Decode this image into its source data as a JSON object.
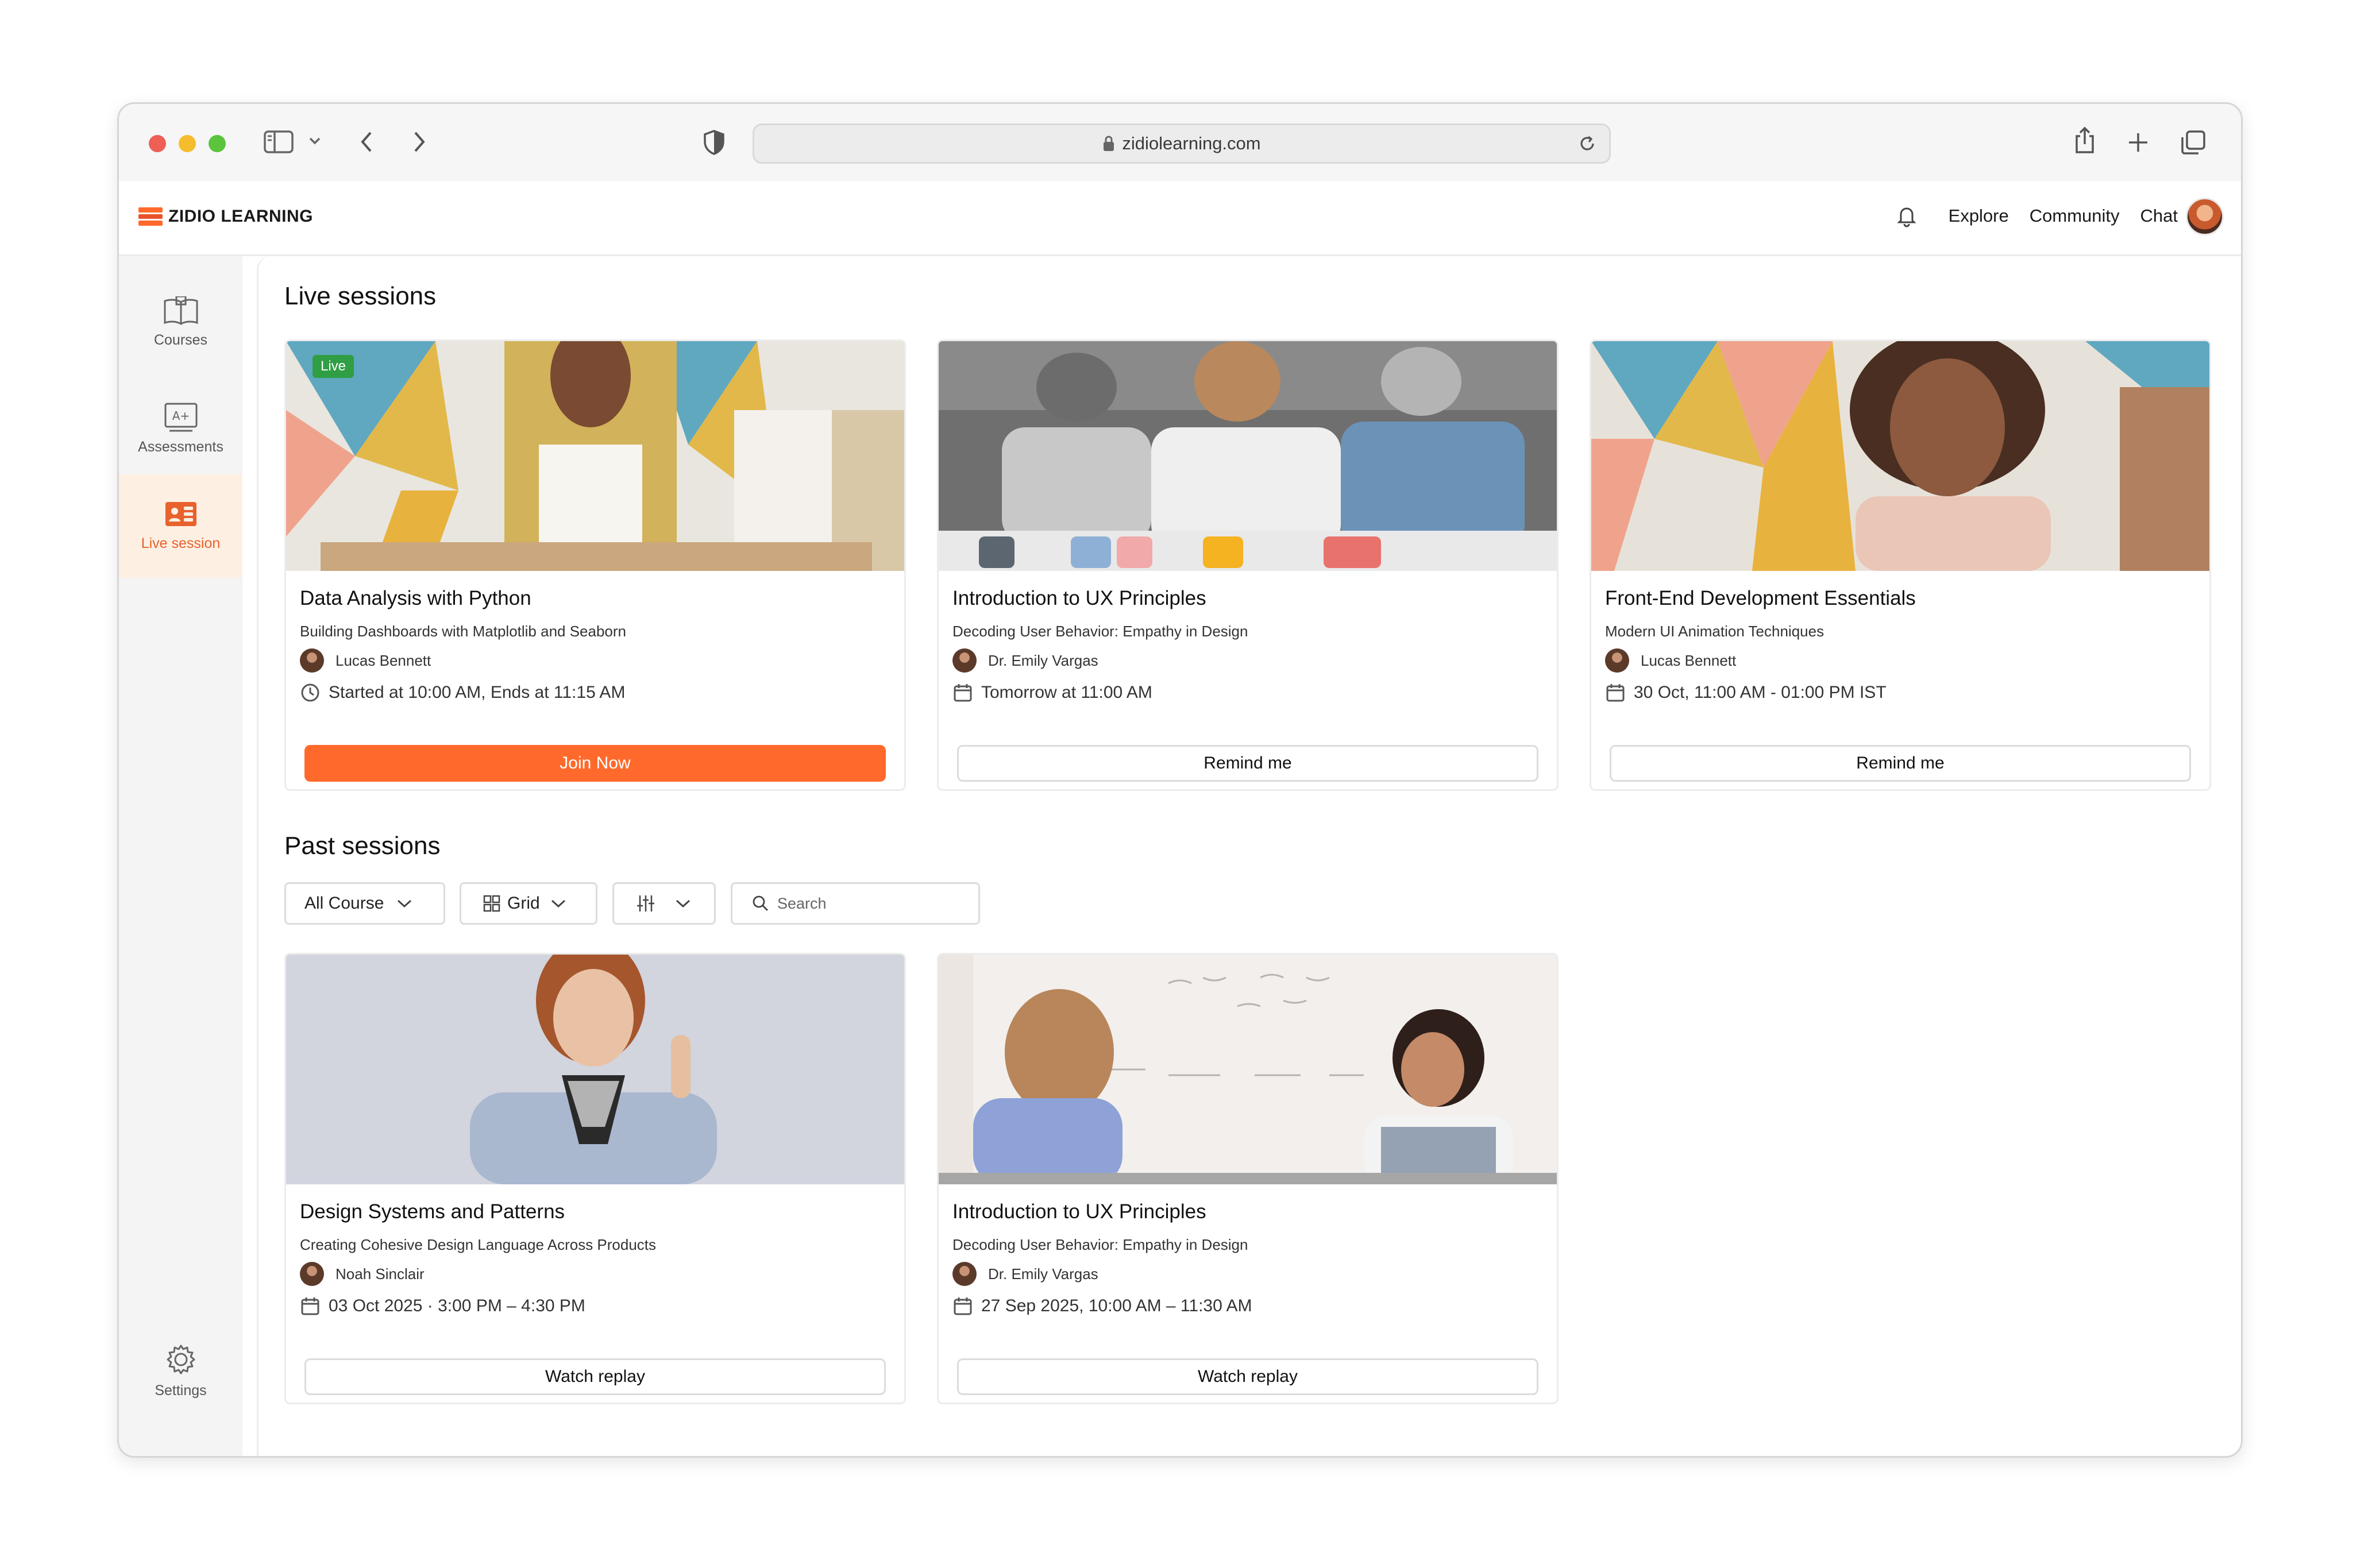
{
  "browser": {
    "url": "zidiolearning.com"
  },
  "header": {
    "brand": "ZIDIO LEARNING",
    "nav": [
      "Explore",
      "Community",
      "Chat"
    ]
  },
  "sidebar": {
    "items": [
      {
        "label": "Courses",
        "icon": "book-icon"
      },
      {
        "label": "Assessments",
        "icon": "grade-icon"
      },
      {
        "label": "Live session",
        "icon": "live-session-icon",
        "active": true
      }
    ],
    "settings": "Settings"
  },
  "live": {
    "title": "Live sessions",
    "badge": "Live",
    "cards": [
      {
        "title": "Data Analysis with Python",
        "subtitle": "Building Dashboards with Matplotlib and Seaborn",
        "instructor": "Lucas Bennett",
        "time": "Started at 10:00 AM, Ends at 11:15 AM",
        "button": "Join Now"
      },
      {
        "title": "Introduction to UX Principles",
        "subtitle": "Decoding User Behavior: Empathy in Design",
        "instructor": "Dr. Emily Vargas",
        "time": "Tomorrow at 11:00 AM",
        "button": "Remind me"
      },
      {
        "title": "Front-End Development Essentials",
        "subtitle": "Modern UI Animation Techniques",
        "instructor": "Lucas Bennett",
        "time": "30 Oct, 11:00 AM - 01:00 PM IST",
        "button": "Remind me"
      }
    ]
  },
  "past": {
    "title": "Past sessions",
    "filters": {
      "course": "All Course",
      "view": "Grid",
      "search_placeholder": "Search"
    },
    "cards": [
      {
        "title": "Design Systems and Patterns",
        "subtitle": "Creating Cohesive Design Language Across Products",
        "instructor": "Noah Sinclair",
        "time": "03 Oct 2025 · 3:00 PM – 4:30 PM",
        "button": "Watch replay"
      },
      {
        "title": "Introduction to UX Principles",
        "subtitle": "Decoding User Behavior: Empathy in Design",
        "instructor": "Dr. Emily Vargas",
        "time": "27 Sep 2025, 10:00 AM – 11:30 AM",
        "button": "Watch replay"
      }
    ]
  },
  "colors": {
    "accent": "#ff6a2c",
    "live_badge": "#2f9e44",
    "active_sidebar_bg": "#fdf0e3"
  }
}
